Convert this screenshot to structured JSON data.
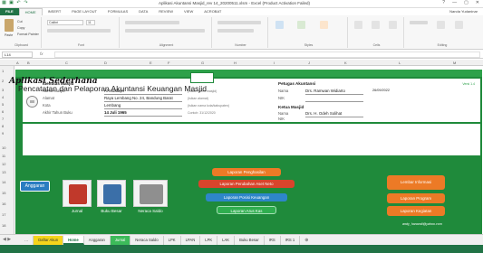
{
  "window": {
    "title": "Aplikasi Akuntansi Masjid_rev 14_20200511.xlsm - Excel (Product Activation Failed)",
    "controls": [
      "?",
      "—",
      "▢",
      "✕"
    ]
  },
  "ribbon": {
    "tabs": [
      "FILE",
      "HOME",
      "INSERT",
      "PAGE LAYOUT",
      "FORMULAS",
      "DATA",
      "REVIEW",
      "VIEW",
      "ACROBAT"
    ],
    "active_tab": "HOME",
    "user": "Nanda Yudaninar",
    "groups": [
      "Clipboard",
      "Font",
      "Alignment",
      "Number",
      "Styles",
      "Cells",
      "Editing"
    ],
    "clipboard": {
      "paste": "Paste",
      "cut": "Cut",
      "copy": "Copy",
      "format_painter": "Format Painter"
    },
    "font": {
      "name": "Calibri",
      "size": "11"
    }
  },
  "formula_bar": {
    "name_box": "L14",
    "fx": "fx",
    "value": ""
  },
  "grid": {
    "columns": [
      "A",
      "B",
      "C",
      "D",
      "E",
      "F",
      "G",
      "H",
      "I",
      "J",
      "K",
      "L",
      "M"
    ],
    "rows": [
      "1",
      "2",
      "3",
      "4",
      "5",
      "6",
      "7",
      "8",
      "9",
      "10",
      "11",
      "12",
      "13",
      "14",
      "15",
      "16",
      "17",
      "18"
    ]
  },
  "identity": {
    "heading": "Identitas Masjid",
    "version": "Versi 1.4",
    "fields": [
      {
        "label": "Nama Masjid",
        "value": "Al Muttaqin",
        "note": "(Isikan nama masjid)"
      },
      {
        "label": "Alamat",
        "value": "Raya Lembang No. 24, Bandung Barat",
        "note": "(Isikan alamat)"
      },
      {
        "label": "Kota",
        "value": "Lembang",
        "note": "(Isikan nama kota/kabupaten)"
      },
      {
        "label": "Akhir Tahun Buku",
        "value": "14 Juli 1965",
        "note": "Contoh: 31/12/2020"
      }
    ],
    "officer_heading": "Petugas Akuntansi",
    "officer": {
      "label": "Nama",
      "value": "Drs. Ramwan Widiarto",
      "date": "26/09/2022",
      "nik_label": "NIK"
    },
    "chair_heading": "Ketua Masjid",
    "chair": {
      "label": "Nama",
      "value": "Drs. H. Odeh Solihat",
      "nik_label": "NIK"
    }
  },
  "title": {
    "app": "Aplikasi Sederhana",
    "subtitle": "Pencatatan dan Pelaporan Akuntansi Keuangan Masjid"
  },
  "actions": {
    "anggaran": "Anggaran",
    "tiles": [
      "Jurnal",
      "Buku Besar",
      "Neraca Saldo"
    ],
    "reports": [
      "Laporan Penghasilan",
      "Laporan Perubahan Aset Neto",
      "Laporan Posisi Keuangan",
      "Laporan Arus Kas"
    ],
    "setup": [
      "Lembar Informasi",
      "Laporan Program",
      "Laporan Kegiatan"
    ],
    "email": "andy_hanandi@yahoo.com"
  },
  "sheets": {
    "tabs": [
      "Daftar Akun",
      "Home",
      "Anggaran",
      "Jurnal",
      "Neraca Saldo",
      "LPK",
      "LPAN",
      "LPK",
      "LAK",
      "Buku Besar",
      "IRS",
      "IRS 1"
    ],
    "active": "Home"
  },
  "colors": {
    "dash_green": "#1f8a3b",
    "accent_green": "#217346",
    "orange": "#ec7a26",
    "red": "#d9442c",
    "blue": "#2e86c9",
    "light_green": "#2fae4f"
  }
}
